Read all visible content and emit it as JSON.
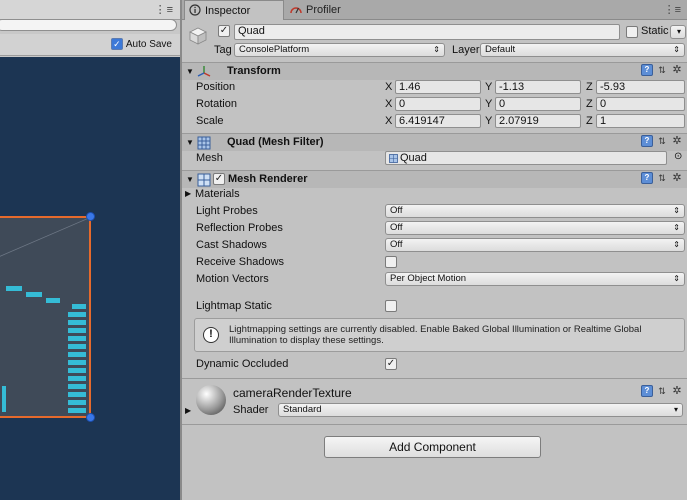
{
  "scene": {
    "auto_save_label": "Auto Save",
    "menu_icon": "ellipsis-menu-icon"
  },
  "tabs": {
    "inspector": "Inspector",
    "profiler": "Profiler"
  },
  "object": {
    "active": true,
    "name": "Quad",
    "static_label": "Static",
    "static_checked": false,
    "tag_label": "Tag",
    "tag_value": "ConsolePlatform",
    "layer_label": "Layer",
    "layer_value": "Default"
  },
  "transform": {
    "title": "Transform",
    "position_label": "Position",
    "rotation_label": "Rotation",
    "scale_label": "Scale",
    "x": "X",
    "y": "Y",
    "z": "Z",
    "position": {
      "x": "1.46",
      "y": "-1.13",
      "z": "-5.93"
    },
    "rotation": {
      "x": "0",
      "y": "0",
      "z": "0"
    },
    "scale": {
      "x": "6.419147",
      "y": "2.07919",
      "z": "1"
    }
  },
  "mesh_filter": {
    "title": "Quad (Mesh Filter)",
    "mesh_label": "Mesh",
    "mesh_value": "Quad"
  },
  "mesh_renderer": {
    "title": "Mesh Renderer",
    "enabled": true,
    "materials_label": "Materials",
    "light_probes_label": "Light Probes",
    "light_probes_value": "Off",
    "reflection_probes_label": "Reflection Probes",
    "reflection_probes_value": "Off",
    "cast_shadows_label": "Cast Shadows",
    "cast_shadows_value": "Off",
    "receive_shadows_label": "Receive Shadows",
    "receive_shadows_checked": false,
    "motion_vectors_label": "Motion Vectors",
    "motion_vectors_value": "Per Object Motion",
    "lightmap_static_label": "Lightmap Static",
    "lightmap_static_checked": false,
    "info_text": "Lightmapping settings are currently disabled. Enable Baked Global Illumination or Realtime Global Illumination to display these settings.",
    "dynamic_occluded_label": "Dynamic Occluded",
    "dynamic_occluded_checked": true
  },
  "material": {
    "name": "cameraRenderTexture",
    "shader_label": "Shader",
    "shader_value": "Standard"
  },
  "add_component_label": "Add Component",
  "colors": {
    "scene_bg": "#1c3553",
    "selection_outline": "#e66a2c",
    "handle": "#3a78e8",
    "bars": "#35bcd6"
  }
}
